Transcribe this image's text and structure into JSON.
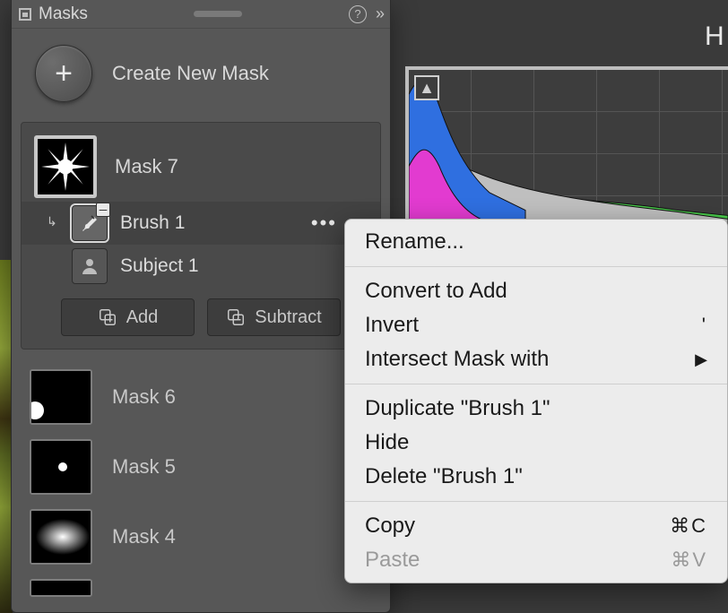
{
  "panel": {
    "title": "Masks",
    "create_label": "Create New Mask",
    "add_label": "Add",
    "subtract_label": "Subtract"
  },
  "masks": {
    "expanded": {
      "label": "Mask 7",
      "components": [
        {
          "label": "Brush 1",
          "kind": "brush",
          "mode": "subtract",
          "selected": true
        },
        {
          "label": "Subject 1",
          "kind": "subject",
          "mode": "add",
          "selected": false
        }
      ]
    },
    "collapsed": [
      {
        "label": "Mask 6"
      },
      {
        "label": "Mask 5"
      },
      {
        "label": "Mask 4"
      }
    ]
  },
  "context_menu": {
    "rename": "Rename...",
    "convert": "Convert to Add",
    "invert": "Invert",
    "invert_shortcut": "'",
    "intersect": "Intersect Mask with",
    "duplicate": "Duplicate \"Brush 1\"",
    "hide": "Hide",
    "delete": "Delete \"Brush 1\"",
    "copy": "Copy",
    "copy_shortcut": "⌘C",
    "paste": "Paste",
    "paste_shortcut": "⌘V"
  },
  "histogram": {
    "header_letter": "H"
  }
}
